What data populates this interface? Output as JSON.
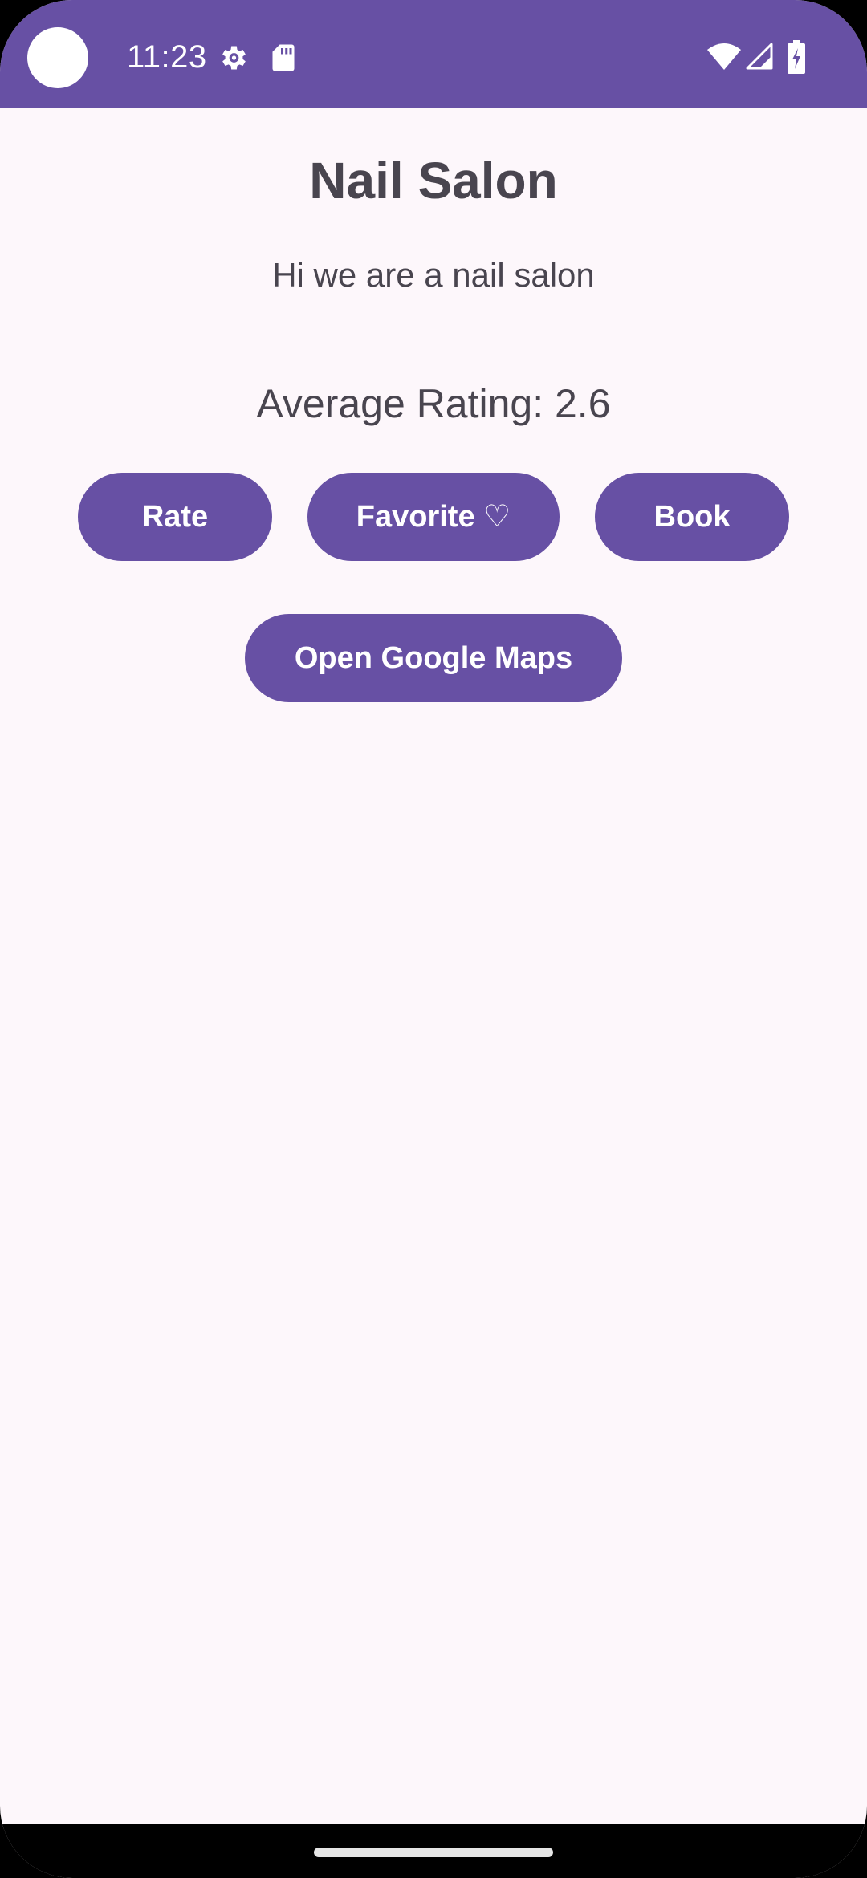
{
  "status_bar": {
    "time": "11:23",
    "icons": [
      "gear-icon",
      "sd-card-icon",
      "wifi-icon",
      "signal-icon",
      "battery-charging-icon"
    ],
    "color": "#6750a4"
  },
  "main": {
    "title": "Nail Salon",
    "description": "Hi we are a nail salon",
    "rating_text": "Average Rating: 2.6"
  },
  "actions": {
    "rate_label": "Rate",
    "favorite_label": "Favorite ♡",
    "book_label": "Book",
    "maps_label": "Open Google Maps"
  },
  "colors": {
    "accent": "#6750a4",
    "background": "#fdf7fb",
    "text": "#49454f"
  }
}
